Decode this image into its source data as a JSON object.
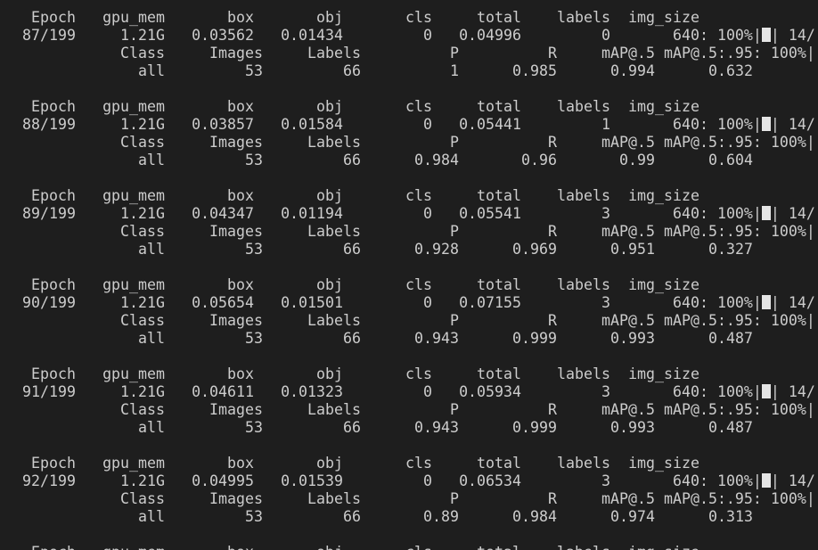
{
  "colors": {
    "background": "#1e1e1e",
    "text": "#cccccc",
    "progress_fill": "#e5e5e5"
  },
  "train_header": [
    "Epoch",
    "gpu_mem",
    "box",
    "obj",
    "cls",
    "total",
    "labels",
    "img_size"
  ],
  "val_header": [
    "Class",
    "Images",
    "Labels",
    "P",
    "R",
    "mAP@.5",
    "mAP@.5:.95: 100%|"
  ],
  "progress": {
    "prefix": "640: 100%|",
    "suffix": "| 14/",
    "percent": 100
  },
  "epochs": [
    {
      "train": [
        "87/199",
        "1.21G",
        "0.03562",
        "0.01434",
        "0",
        "0.04996",
        "0"
      ],
      "val": [
        "all",
        "53",
        "66",
        "1",
        "0.985",
        "0.994",
        "0.632"
      ]
    },
    {
      "train": [
        "88/199",
        "1.21G",
        "0.03857",
        "0.01584",
        "0",
        "0.05441",
        "1"
      ],
      "val": [
        "all",
        "53",
        "66",
        "0.984",
        "0.96",
        "0.99",
        "0.604"
      ]
    },
    {
      "train": [
        "89/199",
        "1.21G",
        "0.04347",
        "0.01194",
        "0",
        "0.05541",
        "3"
      ],
      "val": [
        "all",
        "53",
        "66",
        "0.928",
        "0.969",
        "0.951",
        "0.327"
      ]
    },
    {
      "train": [
        "90/199",
        "1.21G",
        "0.05654",
        "0.01501",
        "0",
        "0.07155",
        "3"
      ],
      "val": [
        "all",
        "53",
        "66",
        "0.943",
        "0.999",
        "0.993",
        "0.487"
      ]
    },
    {
      "train": [
        "91/199",
        "1.21G",
        "0.04611",
        "0.01323",
        "0",
        "0.05934",
        "3"
      ],
      "val": [
        "all",
        "53",
        "66",
        "0.943",
        "0.999",
        "0.993",
        "0.487"
      ]
    },
    {
      "train": [
        "92/199",
        "1.21G",
        "0.04995",
        "0.01539",
        "0",
        "0.06534",
        "3"
      ],
      "val": [
        "all",
        "53",
        "66",
        "0.89",
        "0.984",
        "0.974",
        "0.313"
      ]
    }
  ]
}
